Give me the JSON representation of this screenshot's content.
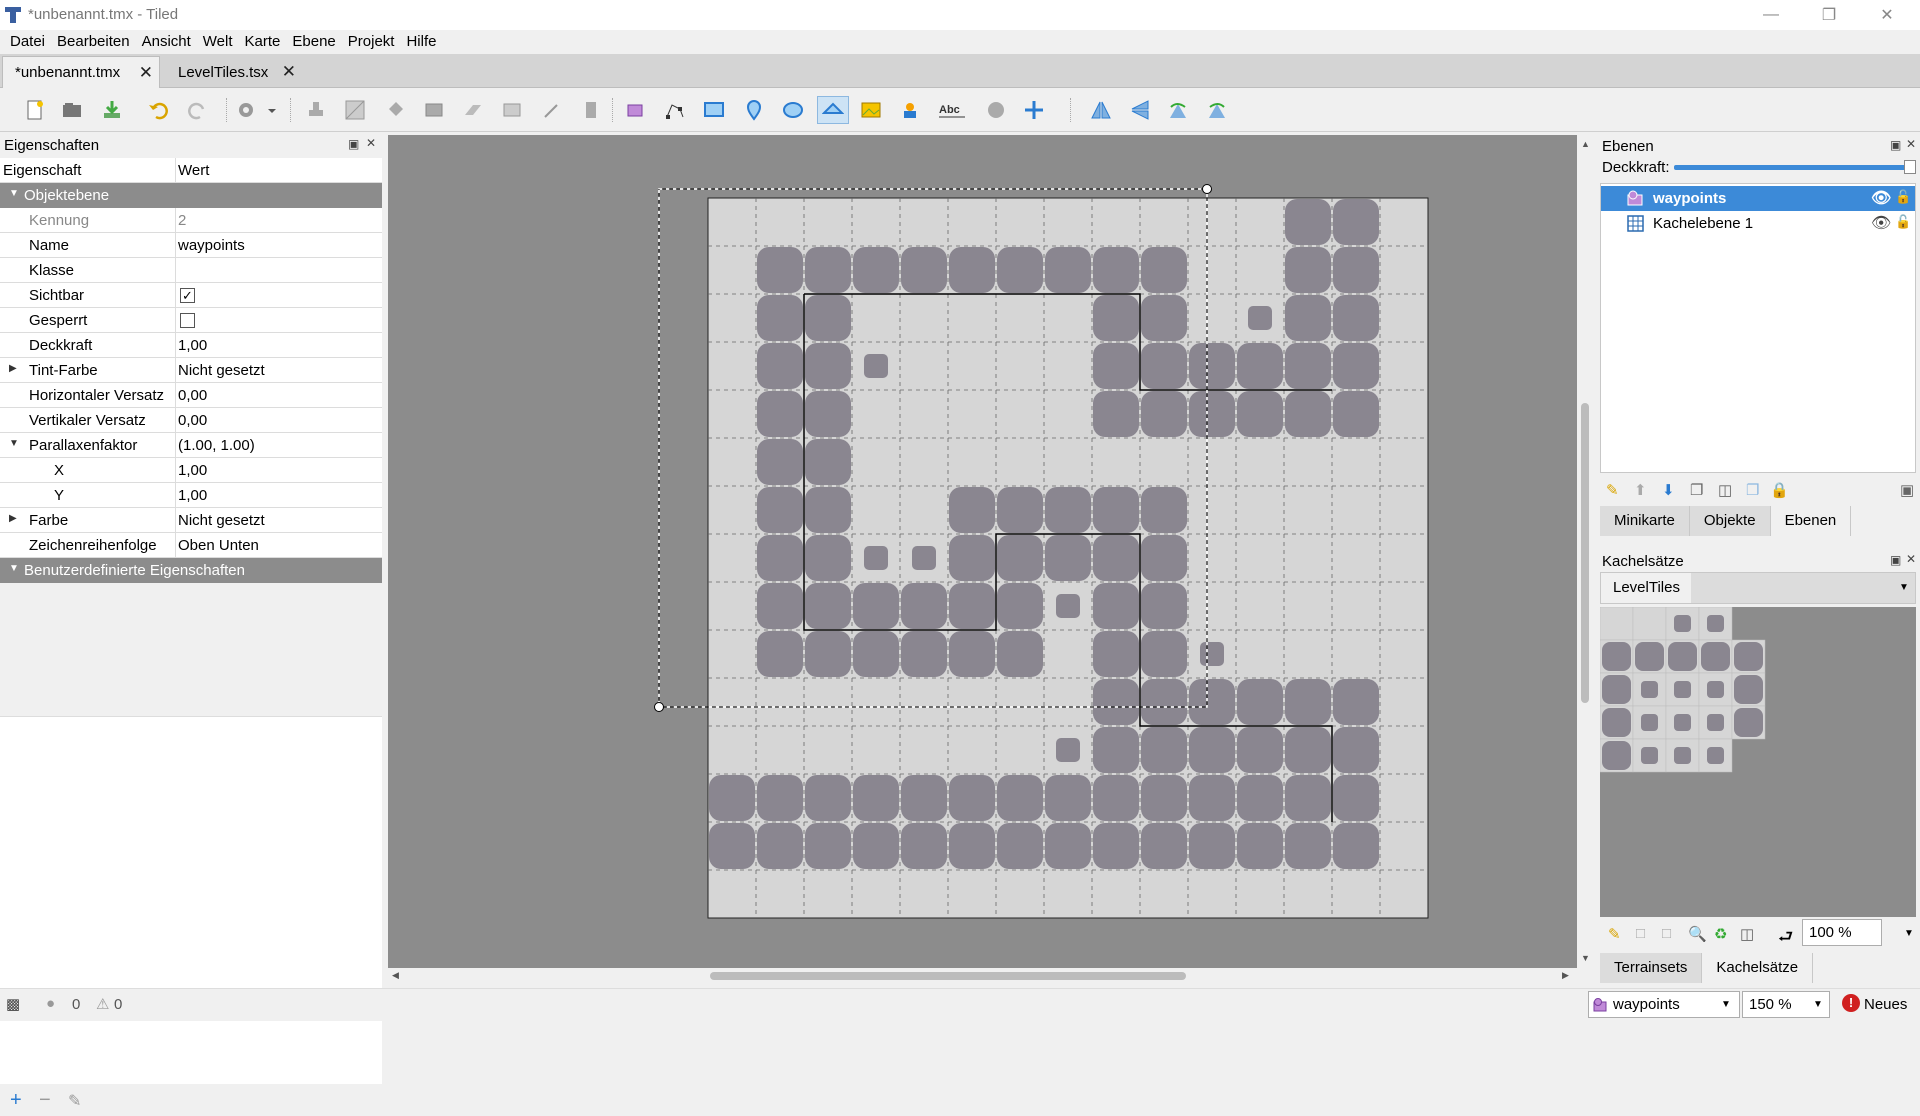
{
  "window": {
    "title": "*unbenannt.tmx - Tiled"
  },
  "menu": [
    "Datei",
    "Bearbeiten",
    "Ansicht",
    "Welt",
    "Karte",
    "Ebene",
    "Projekt",
    "Hilfe"
  ],
  "tabs": [
    {
      "label": "*unbenannt.tmx",
      "active": true
    },
    {
      "label": "LevelTiles.tsx",
      "active": false
    }
  ],
  "properties": {
    "title": "Eigenschaften",
    "col_property": "Eigenschaft",
    "col_value": "Wert",
    "group_object_layer": "Objektebene",
    "rows": [
      {
        "key": "Kennung",
        "value": "2"
      },
      {
        "key": "Name",
        "value": "waypoints"
      },
      {
        "key": "Klasse",
        "value": ""
      },
      {
        "key": "Sichtbar",
        "value": "✓"
      },
      {
        "key": "Gesperrt",
        "value": ""
      },
      {
        "key": "Deckkraft",
        "value": "1,00"
      },
      {
        "key": "Tint-Farbe",
        "value": "Nicht gesetzt"
      },
      {
        "key": "Horizontaler Versatz",
        "value": "0,00"
      },
      {
        "key": "Vertikaler Versatz",
        "value": "0,00"
      },
      {
        "key": "Parallaxenfaktor",
        "value": "(1.00, 1.00)"
      },
      {
        "key": "X",
        "value": "1,00"
      },
      {
        "key": "Y",
        "value": "1,00"
      },
      {
        "key": "Farbe",
        "value": "Nicht gesetzt"
      },
      {
        "key": "Zeichenreihenfolge",
        "value": "Oben Unten"
      }
    ],
    "group_custom": "Benutzerdefinierte Eigenschaften"
  },
  "layers": {
    "title": "Ebenen",
    "opacity_label": "Deckkraft:",
    "items": [
      {
        "name": "waypoints",
        "type": "object",
        "selected": true
      },
      {
        "name": "Kachelebene 1",
        "type": "tile",
        "selected": false
      }
    ],
    "tabs": [
      "Minikarte",
      "Objekte",
      "Ebenen"
    ],
    "active_tab": "Ebenen"
  },
  "tilesets": {
    "title": "Kachelsätze",
    "tab": "LevelTiles",
    "zoom": "100 %",
    "bottom_tabs": [
      "Terrainsets",
      "Kachelsätze"
    ]
  },
  "status": {
    "errors": "0",
    "warnings": "0",
    "layer_combo": "waypoints",
    "zoom": "150 %",
    "news": "Neues"
  },
  "colors": {
    "selection": "#3c8ad8",
    "canvas_bg": "#8c8c8c",
    "path_tile": "#8a8690",
    "floor_tile": "#d6d6d6"
  }
}
